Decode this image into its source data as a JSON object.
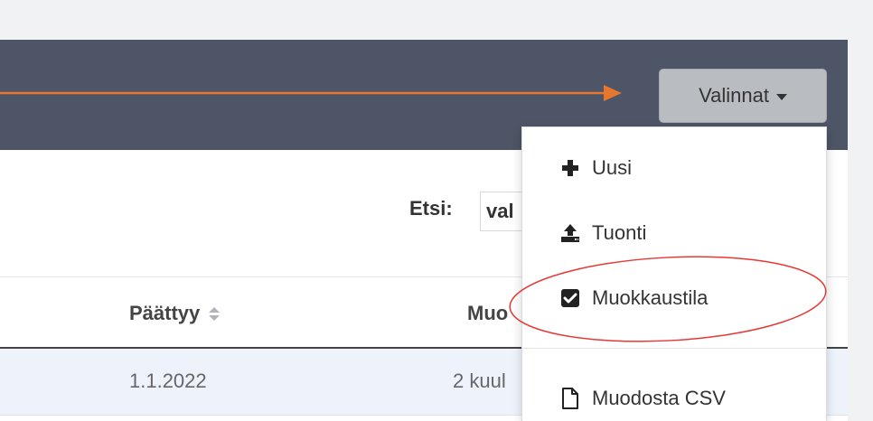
{
  "toolbar": {
    "options_label": "Valinnat"
  },
  "search": {
    "label": "Etsi:",
    "value": "val"
  },
  "table": {
    "columns": [
      "Päättyy",
      "Muo"
    ],
    "rows": [
      {
        "paattyy": "1.1.2022",
        "muoto": "2 kuul"
      }
    ]
  },
  "menu": {
    "items": [
      {
        "label": "Uusi",
        "icon": "plus-icon"
      },
      {
        "label": "Tuonti",
        "icon": "upload-icon"
      },
      {
        "label": "Muokkaustila",
        "icon": "checkbox-checked-icon"
      },
      {
        "label": "Muodosta CSV",
        "icon": "file-icon"
      }
    ]
  },
  "colors": {
    "header": "#4d5566",
    "arrow": "#e8772e",
    "highlight_circle": "#e53935"
  }
}
